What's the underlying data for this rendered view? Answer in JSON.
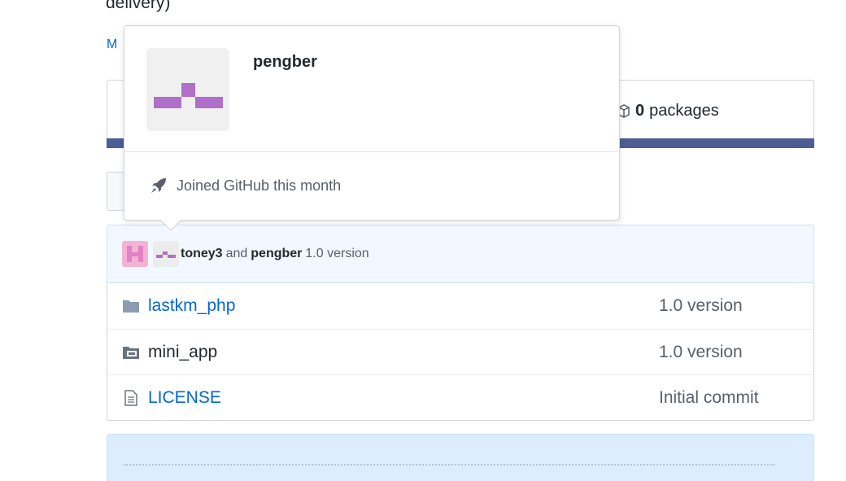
{
  "repo": {
    "description_fragment": "delivery)",
    "manage_topics_fragment": "M",
    "packages_count": "0",
    "packages_label": "packages",
    "language_color": "#4f5d95"
  },
  "latest_commit": {
    "author1": "toney3",
    "conjunction": "and",
    "author2": "pengber",
    "message": "1.0 version"
  },
  "files": [
    {
      "name": "lastkm_php",
      "type": "folder",
      "message": "1.0 version",
      "icon": "folder-icon"
    },
    {
      "name": "mini_app",
      "type": "submodule",
      "message": "1.0 version",
      "icon": "folder-submodule-icon"
    },
    {
      "name": "LICENSE",
      "type": "file",
      "message": "Initial commit",
      "icon": "file-text-icon"
    }
  ],
  "hovercard": {
    "login": "pengber",
    "joined_text": "Joined GitHub this month",
    "icon": "rocket-icon"
  }
}
